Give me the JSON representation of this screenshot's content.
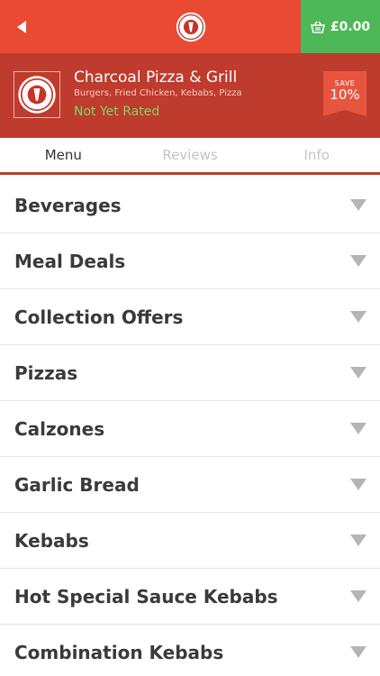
{
  "topbar": {
    "basket_amount": "£0.00",
    "logo_text": "CHARCOAL PIZZA & GRILL"
  },
  "restaurant": {
    "name": "Charcoal Pizza & Grill",
    "cuisines": "Burgers, Fried Chicken, Kebabs, Pizza",
    "rating": "Not Yet Rated",
    "save_label": "SAVE",
    "save_pct": "10%"
  },
  "tabs": [
    {
      "label": "Menu",
      "active": true
    },
    {
      "label": "Reviews",
      "active": false
    },
    {
      "label": "Info",
      "active": false
    }
  ],
  "menu": {
    "categories": [
      "Beverages",
      "Meal Deals",
      "Collection Offers",
      "Pizzas",
      "Calzones",
      "Garlic Bread",
      "Kebabs",
      "Hot Special Sauce Kebabs",
      "Combination Kebabs"
    ]
  },
  "colors": {
    "topbar": "#e84a34",
    "header": "#bf3b2d",
    "basket": "#4cb857",
    "rating": "#7ed36b"
  },
  "icons": {
    "back": "back-arrow-icon",
    "basket": "basket-icon",
    "expand": "chevron-down-icon"
  }
}
